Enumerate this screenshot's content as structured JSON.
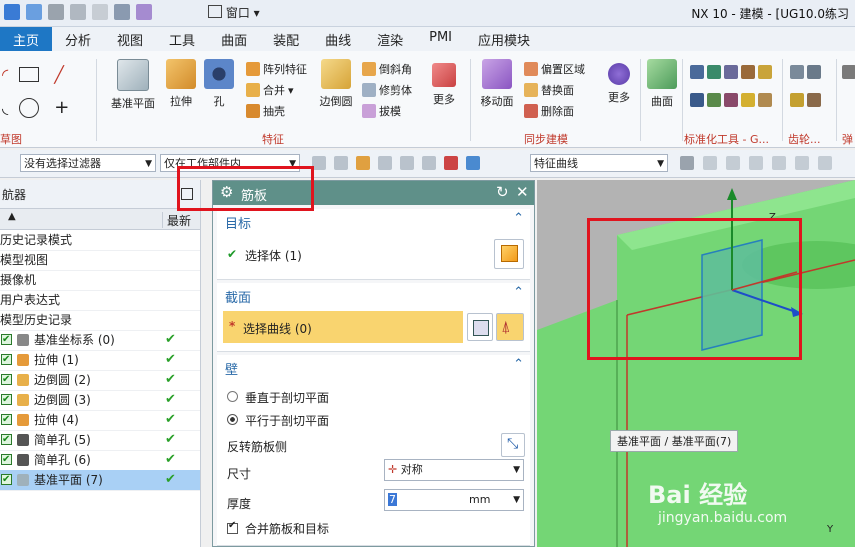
{
  "window": {
    "title": "NX 10 - 建模 - [UG10.0练习",
    "menu_label": "窗口"
  },
  "tabs": [
    {
      "label": "主页"
    },
    {
      "label": "分析"
    },
    {
      "label": "视图"
    },
    {
      "label": "工具"
    },
    {
      "label": "曲面"
    },
    {
      "label": "装配"
    },
    {
      "label": "曲线"
    },
    {
      "label": "渲染"
    },
    {
      "label": "PMI"
    },
    {
      "label": "应用模块"
    }
  ],
  "ribbon": {
    "groups": {
      "sketch": "草图",
      "feature": "特征",
      "sync": "同步建模",
      "stdtools": "标准化工具 - G...",
      "gear": "齿轮...",
      "spring": "弹"
    },
    "buttons": {
      "datum_plane": "基准平面",
      "extrude": "拉伸",
      "hole": "孔",
      "pattern_feature": "阵列特征",
      "unite": "合并",
      "shell": "抽壳",
      "edge_blend": "边倒圆",
      "chamfer": "倒斜角",
      "trim_body": "修剪体",
      "draft": "拔模",
      "more1": "更多",
      "move_face": "移动面",
      "offset_region": "偏置区域",
      "replace_face": "替换面",
      "delete_face": "删除面",
      "more2": "更多",
      "surface": "曲面"
    }
  },
  "toolbar": {
    "filter": "没有选择过滤器",
    "scope": "仅在工作部件内",
    "curve_rule": "特征曲线"
  },
  "navigator": {
    "title": "航器",
    "col_latest": "最新",
    "items": [
      {
        "label": "历史记录模式",
        "type": "plain"
      },
      {
        "label": "模型视图",
        "type": "plain"
      },
      {
        "label": "摄像机",
        "type": "plain"
      },
      {
        "label": "用户表达式",
        "type": "plain"
      },
      {
        "label": "模型历史记录",
        "type": "plain"
      },
      {
        "label": "基准坐标系 (0)",
        "type": "feature"
      },
      {
        "label": "拉伸 (1)",
        "type": "feature"
      },
      {
        "label": "边倒圆 (2)",
        "type": "feature"
      },
      {
        "label": "边倒圆 (3)",
        "type": "feature"
      },
      {
        "label": "拉伸 (4)",
        "type": "feature"
      },
      {
        "label": "简单孔 (5)",
        "type": "feature"
      },
      {
        "label": "简单孔 (6)",
        "type": "feature"
      },
      {
        "label": "基准平面 (7)",
        "type": "feature",
        "selected": true
      }
    ]
  },
  "dialog": {
    "title": "筋板",
    "target": {
      "title": "目标",
      "select_body": "选择体 (1)"
    },
    "section": {
      "title": "截面",
      "select_curve": "选择曲线 (0)"
    },
    "wall": {
      "title": "壁",
      "perpendicular": "垂直于剖切平面",
      "parallel": "平行于剖切平面",
      "reverse": "反转筋板侧",
      "size_label": "尺寸",
      "size_value": "对称",
      "thickness_label": "厚度",
      "thickness_value": "7",
      "thickness_unit": "mm",
      "merge": "合并筋板和目标"
    }
  },
  "viewport": {
    "tooltip": "基准平面 / 基准平面(7)",
    "axis_z": "Z",
    "axis_y": "Y",
    "watermark": "Bai 经验",
    "watermark_url": "jingyan.baidu.com"
  },
  "colors": {
    "accent": "#1e77c5",
    "dialog_header": "#5f9089",
    "model_green": "#6fcf6f",
    "highlight": "#e0141e"
  }
}
